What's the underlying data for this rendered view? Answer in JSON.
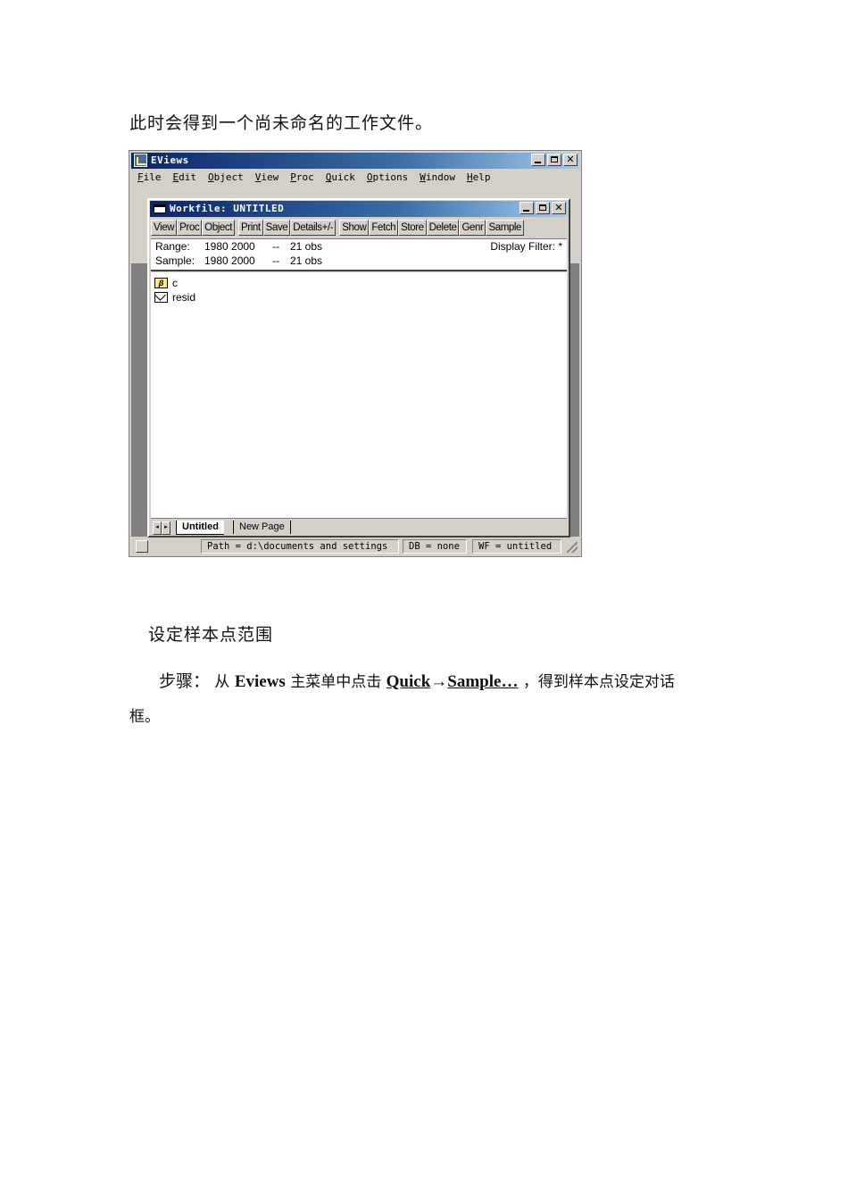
{
  "doc": {
    "intro": "此时会得到一个尚未命名的工作文件。",
    "heading": "设定样本点范围",
    "step_label": "步骤：",
    "step_prefix": "从",
    "step_app": "Eviews",
    "step_mid": "主菜单中点击",
    "step_menu1": "Quick",
    "step_arrow": "→",
    "step_menu2": "Sample…",
    "step_suffix": "，得到样本点设定对话",
    "step_cont": "框。"
  },
  "app": {
    "title": "EViews",
    "menu": [
      "File",
      "Edit",
      "Object",
      "View",
      "Proc",
      "Quick",
      "Options",
      "Window",
      "Help"
    ]
  },
  "workfile": {
    "title": "Workfile: UNTITLED",
    "toolbar_group1": [
      "View",
      "Proc",
      "Object"
    ],
    "toolbar_group2": [
      "Print",
      "Save",
      "Details+/-"
    ],
    "toolbar_group3": [
      "Show",
      "Fetch",
      "Store",
      "Delete",
      "Genr",
      "Sample"
    ],
    "range_label": "Range:",
    "range_value": "1980 2000",
    "range_sep": "--",
    "range_obs": "21 obs",
    "sample_label": "Sample:",
    "sample_value": "1980 2000",
    "sample_sep": "--",
    "sample_obs": "21 obs",
    "display_filter": "Display Filter: *",
    "objects": [
      {
        "name": "c",
        "icon": "coefficient-icon",
        "glyph": "β"
      },
      {
        "name": "resid",
        "icon": "series-icon"
      }
    ],
    "tabs": [
      "Untitled",
      "New Page"
    ]
  },
  "statusbar": {
    "path": "Path = d:\\documents and settings",
    "db": "DB = none",
    "wf": "WF = untitled"
  }
}
